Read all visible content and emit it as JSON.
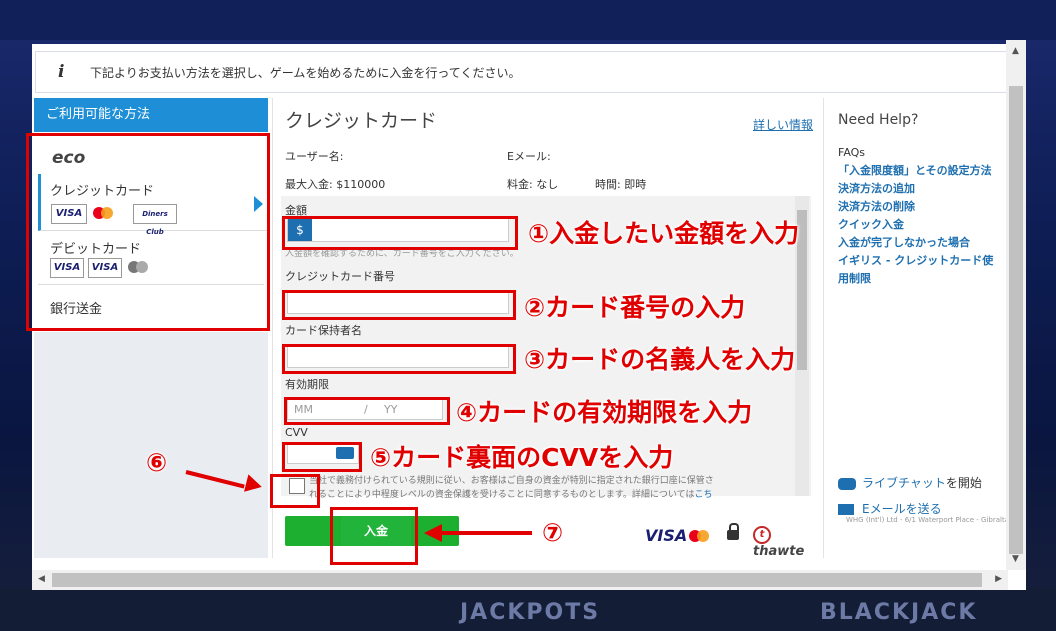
{
  "info_message": "下記よりお支払い方法を選択し、ゲームを始めるために入金を行ってください。",
  "methods": {
    "header": "ご利用可能な方法",
    "eco_logo": "eco",
    "credit_label": "クレジットカード",
    "debit_label": "デビットカード",
    "bank_label": "銀行送金",
    "card_logos": {
      "visa": "VISA",
      "diners": "Diners Club"
    }
  },
  "center": {
    "title": "クレジットカード",
    "more_info": "詳しい情報",
    "username_label": "ユーザー名:",
    "email_label": "Eメール:",
    "max_deposit": "最大入金: $110000",
    "fee": "料金: なし",
    "time": "時間: 即時"
  },
  "form": {
    "amount_label": "金額",
    "currency": "$",
    "amount_help": "入金額を確認するために、カード番号をご入力ください。",
    "card_number_label": "クレジットカード番号",
    "holder_label": "カード保持者名",
    "expiry_label": "有効期限",
    "expiry_mm": "MM",
    "expiry_sep": "/",
    "expiry_yy": "YY",
    "cvv_label": "CVV",
    "terms_line1": "当社で義務付けられている規則に従い、お客様はご自身の資金が特別に指定された銀行口座に保管さ",
    "terms_line2": "れることにより中程度レベルの資金保護を受けることに同意するものとします。詳細については",
    "terms_link": "こち",
    "deposit_button": "入金",
    "visa": "VISA",
    "thawte": "thawte",
    "thawte_mark": "t"
  },
  "help": {
    "title": "Need Help?",
    "faq_label": "FAQs",
    "links": [
      "「入金限度額」とその設定方法",
      "決済方法の追加",
      "決済方法の削除",
      "クイック入金",
      "入金が完了しなかった場合",
      "イギリス - クレジットカード使",
      "用制限"
    ],
    "chat_link": "ライブチャット",
    "chat_suffix": "を開始",
    "email_link": "Eメールを送る",
    "copyright": "WHG (Int'l) Ltd - 6/1 Waterport Place - Gibraltar"
  },
  "annotations": {
    "step1": "①入金したい金額を入力",
    "step2": "②カード番号の入力",
    "step3": "③カードの名義人を入力",
    "step4": "④カードの有効期限を入力",
    "step5": "⑤カード裏面のCVVを入力",
    "step6": "⑥",
    "step7": "⑦"
  },
  "background": {
    "bottom_left": "JACKPOTS",
    "bottom_right": "BLACKJACK"
  },
  "colors": {
    "accent": "#1e8fd6",
    "annotation": "#e00000",
    "deposit_green": "#22b43a",
    "link": "#1e6fb0"
  }
}
